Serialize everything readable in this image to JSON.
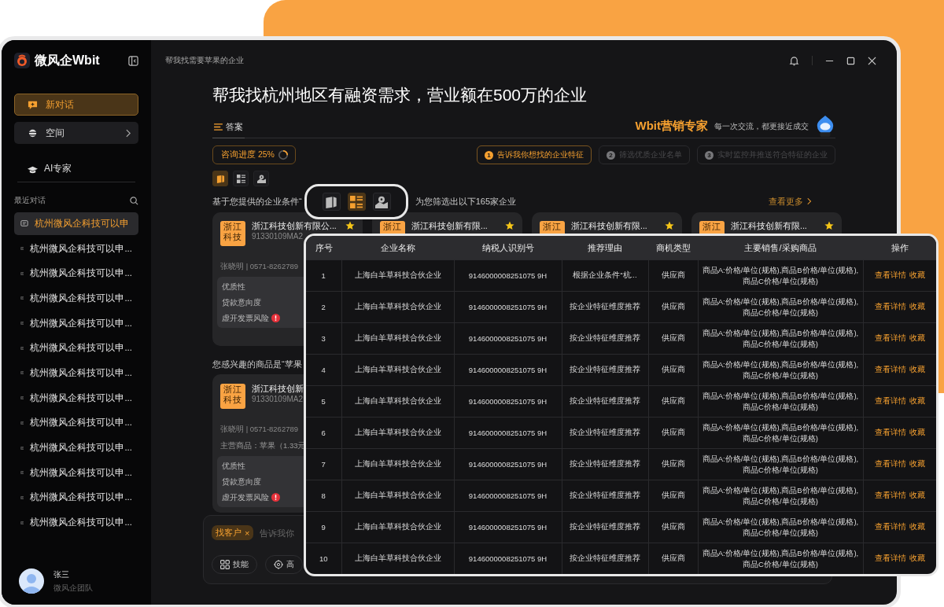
{
  "sidebar": {
    "logo": "微风企Wbit",
    "nav": [
      {
        "kind": "new",
        "label": "新对话",
        "selected": true
      },
      {
        "kind": "space",
        "label": "空间",
        "selected": false
      },
      {
        "kind": "expert",
        "label": "AI专家",
        "selected": false
      }
    ],
    "recent_title": "最近对话",
    "recent": [
      {
        "label": "杭州微风企科技可以申",
        "selected": true
      },
      {
        "label": "杭州微风企科技可以申...",
        "selected": false
      },
      {
        "label": "杭州微风企科技可以申...",
        "selected": false
      },
      {
        "label": "杭州微风企科技可以申...",
        "selected": false
      },
      {
        "label": "杭州微风企科技可以申...",
        "selected": false
      },
      {
        "label": "杭州微风企科技可以申...",
        "selected": false
      },
      {
        "label": "杭州微风企科技可以申...",
        "selected": false
      },
      {
        "label": "杭州微风企科技可以申...",
        "selected": false
      },
      {
        "label": "杭州微风企科技可以申...",
        "selected": false
      },
      {
        "label": "杭州微风企科技可以申...",
        "selected": false
      },
      {
        "label": "杭州微风企科技可以申...",
        "selected": false
      },
      {
        "label": "杭州微风企科技可以申...",
        "selected": false
      },
      {
        "label": "杭州微风企科技可以申...",
        "selected": false
      }
    ],
    "user": {
      "name": "张三",
      "team": "微风企团队"
    }
  },
  "header": {
    "breadcrumb": "帮我找需要苹果的企业"
  },
  "question": "帮我找杭州地区有融资需求，营业额在500万的企业",
  "answer_tab": "答案",
  "expert": {
    "name": "Wbit营销专家",
    "slogan": "每一次交流，都更接近成交"
  },
  "progress": {
    "label": "咨询进度 25%",
    "level": 0.25
  },
  "steps": [
    {
      "number": "1",
      "label": "告诉我你想找的企业特征",
      "active": true
    },
    {
      "number": "2",
      "label": "筛选优质企业名单",
      "active": false
    },
    {
      "number": "3",
      "label": "实时监控并推送符合特征的企业",
      "active": false
    }
  ],
  "views": [
    {
      "kind": "cards",
      "selected": true
    },
    {
      "kind": "list",
      "selected": false
    },
    {
      "kind": "map",
      "selected": false
    }
  ],
  "results_intro": [
    "基于您提供的企业条件“",
    "为您筛选出以下165家企业"
  ],
  "more_link": "查看更多",
  "cards": [
    {
      "badge": [
        "浙江",
        "科技"
      ],
      "name": "浙江科技创新有限公...",
      "starred": true,
      "code": "91330109MA2",
      "contact": "张晓明 | 0571-8262789",
      "metrics": [
        {
          "label": "优质性",
          "warning": false
        },
        {
          "label": "贷款意向度",
          "warning": false
        },
        {
          "label": "虚开发票风险",
          "warning": true
        }
      ]
    },
    {
      "badge": [
        "浙江"
      ],
      "name": "浙江科技创新有限...",
      "starred": true
    },
    {
      "badge": [
        "浙江"
      ],
      "name": "浙江科技创新有限...",
      "starred": true
    },
    {
      "badge": [
        "浙江"
      ],
      "name": "浙江科技创新有限...",
      "starred": true
    }
  ],
  "interest_intro": "您感兴趣的商品是“苹果",
  "interest_cards": [
    {
      "badge": [
        "浙江",
        "科技"
      ],
      "name": "浙江科技创新",
      "code": "91330109MA2",
      "contact": "张晓明 | 0571-8262789",
      "goods": "主营商品：苹果（1.33元",
      "metrics": [
        {
          "label": "优质性",
          "warning": false
        },
        {
          "label": "贷款意向度",
          "warning": false
        },
        {
          "label": "虚开发票风险",
          "warning": true
        }
      ]
    }
  ],
  "composer": {
    "chip": "找客户",
    "chip_close": "×",
    "placeholder": "告诉我你",
    "tools": [
      {
        "kind": "skills",
        "label": "技能"
      },
      {
        "kind": "advanced",
        "label": "高"
      }
    ]
  },
  "callout_views": [
    {
      "kind": "cards",
      "selected": false
    },
    {
      "kind": "list",
      "selected": true
    },
    {
      "kind": "map",
      "selected": false
    }
  ],
  "table": {
    "columns": [
      "序号",
      "企业名称",
      "纳税人识别号",
      "推荐理由",
      "商机类型",
      "主要销售/采购商品",
      "操作"
    ],
    "rows": [
      {
        "index": "1",
        "company": "上海白羊草科技合伙企业",
        "tax_id": "9146000008251075 9H",
        "reason": "根据企业条件“杭...",
        "type": "供应商",
        "goods": "商品A:价格/单位(规格),商品B价格/单位(规格),商品C价格/单位(规格)",
        "actions": [
          "查看详情",
          "收藏"
        ]
      },
      {
        "index": "2",
        "company": "上海白羊草科技合伙企业",
        "tax_id": "9146000008251075 9H",
        "reason": "按企业特征维度推荐",
        "type": "供应商",
        "goods": "商品A:价格/单位(规格),商品B价格/单位(规格),商品C价格/单位(规格)",
        "actions": [
          "查看详情",
          "收藏"
        ]
      },
      {
        "index": "3",
        "company": "上海白羊草科技合伙企业",
        "tax_id": "9146000008251075 9H",
        "reason": "按企业特征维度推荐",
        "type": "供应商",
        "goods": "商品A:价格/单位(规格),商品B价格/单位(规格),商品C价格/单位(规格)",
        "actions": [
          "查看详情",
          "收藏"
        ]
      },
      {
        "index": "4",
        "company": "上海白羊草科技合伙企业",
        "tax_id": "9146000008251075 9H",
        "reason": "按企业特征维度推荐",
        "type": "供应商",
        "goods": "商品A:价格/单位(规格),商品B价格/单位(规格),商品C价格/单位(规格)",
        "actions": [
          "查看详情",
          "收藏"
        ]
      },
      {
        "index": "5",
        "company": "上海白羊草科技合伙企业",
        "tax_id": "9146000008251075 9H",
        "reason": "按企业特征维度推荐",
        "type": "供应商",
        "goods": "商品A:价格/单位(规格),商品B价格/单位(规格),商品C价格/单位(规格)",
        "actions": [
          "查看详情",
          "收藏"
        ]
      },
      {
        "index": "6",
        "company": "上海白羊草科技合伙企业",
        "tax_id": "9146000008251075 9H",
        "reason": "按企业特征维度推荐",
        "type": "供应商",
        "goods": "商品A:价格/单位(规格),商品B价格/单位(规格),商品C价格/单位(规格)",
        "actions": [
          "查看详情",
          "收藏"
        ]
      },
      {
        "index": "7",
        "company": "上海白羊草科技合伙企业",
        "tax_id": "9146000008251075 9H",
        "reason": "按企业特征维度推荐",
        "type": "供应商",
        "goods": "商品A:价格/单位(规格),商品B价格/单位(规格),商品C价格/单位(规格)",
        "actions": [
          "查看详情",
          "收藏"
        ]
      },
      {
        "index": "8",
        "company": "上海白羊草科技合伙企业",
        "tax_id": "9146000008251075 9H",
        "reason": "按企业特征维度推荐",
        "type": "供应商",
        "goods": "商品A:价格/单位(规格),商品B价格/单位(规格),商品C价格/单位(规格)",
        "actions": [
          "查看详情",
          "收藏"
        ]
      },
      {
        "index": "9",
        "company": "上海白羊草科技合伙企业",
        "tax_id": "9146000008251075 9H",
        "reason": "按企业特征维度推荐",
        "type": "供应商",
        "goods": "商品A:价格/单位(规格),商品B价格/单位(规格),商品C价格/单位(规格)",
        "actions": [
          "查看详情",
          "收藏"
        ]
      },
      {
        "index": "10",
        "company": "上海白羊草科技合伙企业",
        "tax_id": "9146000008251075 9H",
        "reason": "按企业特征维度推荐",
        "type": "供应商",
        "goods": "商品A:价格/单位(规格),商品B价格/单位(规格),商品C价格/单位(规格)",
        "actions": [
          "查看详情",
          "收藏"
        ]
      }
    ]
  }
}
